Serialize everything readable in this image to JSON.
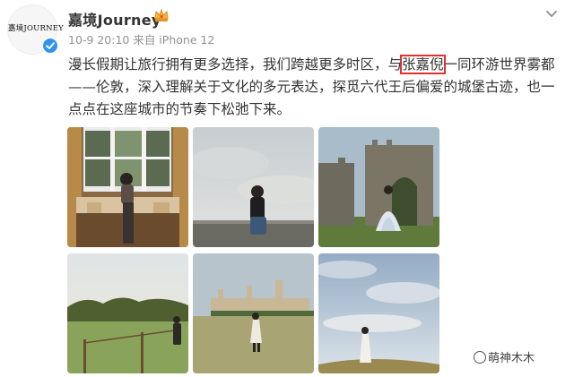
{
  "user": {
    "avatar_text": "嘉境JOURNEY",
    "name": "嘉境Journey",
    "meta": "10-9 20:10 来自 iPhone 12"
  },
  "post": {
    "text_before": "漫长假期让旅行拥有更多选择，我们跨越更多时区，与",
    "mention": "张嘉倪",
    "text_after": "一同环游世界雾都——伦敦，深入理解关于文化的多元表达，探觅六代王后偏爱的城堡古迹，也一点点在这座城市的节奏下松弛下来。"
  },
  "photos": [
    {
      "subject": "woman seated on window seat"
    },
    {
      "subject": "woman sitting on stone wall"
    },
    {
      "subject": "woman in gown before castle ruin"
    },
    {
      "subject": "woman in field with fence"
    },
    {
      "subject": "woman before Leeds Castle"
    },
    {
      "subject": "woman in white dress on hill"
    }
  ],
  "watermark": "萌神木木",
  "icons": [
    "verified-icon",
    "crown-icon",
    "chevron-down-icon",
    "camera-icon"
  ],
  "colors": {
    "accent": "#2f93f6",
    "highlight_box": "#e03030",
    "meta_text": "#939393"
  }
}
